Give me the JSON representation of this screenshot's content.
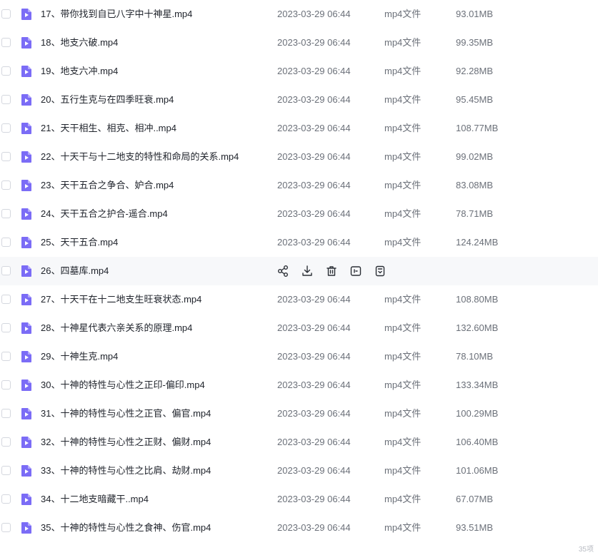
{
  "files": [
    {
      "name": "17、带你找到自已八字中十神星.mp4",
      "date": "2023-03-29 06:44",
      "type": "mp4文件",
      "size": "93.01MB"
    },
    {
      "name": "18、地支六破.mp4",
      "date": "2023-03-29 06:44",
      "type": "mp4文件",
      "size": "99.35MB"
    },
    {
      "name": "19、地支六冲.mp4",
      "date": "2023-03-29 06:44",
      "type": "mp4文件",
      "size": "92.28MB"
    },
    {
      "name": "20、五行生克与在四季旺衰.mp4",
      "date": "2023-03-29 06:44",
      "type": "mp4文件",
      "size": "95.45MB"
    },
    {
      "name": "21、天干相生、相克、相冲..mp4",
      "date": "2023-03-29 06:44",
      "type": "mp4文件",
      "size": "108.77MB"
    },
    {
      "name": "22、十天干与十二地支的特性和命局的关系.mp4",
      "date": "2023-03-29 06:44",
      "type": "mp4文件",
      "size": "99.02MB"
    },
    {
      "name": "23、天干五合之争合、妒合.mp4",
      "date": "2023-03-29 06:44",
      "type": "mp4文件",
      "size": "83.08MB"
    },
    {
      "name": "24、天干五合之护合-遥合.mp4",
      "date": "2023-03-29 06:44",
      "type": "mp4文件",
      "size": "78.71MB"
    },
    {
      "name": "25、天干五合.mp4",
      "date": "2023-03-29 06:44",
      "type": "mp4文件",
      "size": "124.24MB"
    },
    {
      "name": "26、四墓库.mp4",
      "date": "",
      "type": "",
      "size": "",
      "hover": true
    },
    {
      "name": "27、十天干在十二地支生旺衰状态.mp4",
      "date": "2023-03-29 06:44",
      "type": "mp4文件",
      "size": "108.80MB"
    },
    {
      "name": "28、十神星代表六亲关系的原理.mp4",
      "date": "2023-03-29 06:44",
      "type": "mp4文件",
      "size": "132.60MB"
    },
    {
      "name": "29、十神生克.mp4",
      "date": "2023-03-29 06:44",
      "type": "mp4文件",
      "size": "78.10MB"
    },
    {
      "name": "30、十神的特性与心性之正印-偏印.mp4",
      "date": "2023-03-29 06:44",
      "type": "mp4文件",
      "size": "133.34MB"
    },
    {
      "name": "31、十神的特性与心性之正官、偏官.mp4",
      "date": "2023-03-29 06:44",
      "type": "mp4文件",
      "size": "100.29MB"
    },
    {
      "name": "32、十神的特性与心性之正财、偏财.mp4",
      "date": "2023-03-29 06:44",
      "type": "mp4文件",
      "size": "106.40MB"
    },
    {
      "name": "33、十神的特性与心性之比肩、劫财.mp4",
      "date": "2023-03-29 06:44",
      "type": "mp4文件",
      "size": "101.06MB"
    },
    {
      "name": "34、十二地支暗藏干..mp4",
      "date": "2023-03-29 06:44",
      "type": "mp4文件",
      "size": "67.07MB"
    },
    {
      "name": "35、十神的特性与心性之食神、伤官.mp4",
      "date": "2023-03-29 06:44",
      "type": "mp4文件",
      "size": "93.51MB"
    }
  ],
  "hover_actions": [
    {
      "icon": "share-icon"
    },
    {
      "icon": "download-icon"
    },
    {
      "icon": "delete-icon"
    },
    {
      "icon": "preview-icon"
    },
    {
      "icon": "more-icon"
    }
  ],
  "watermark": "35项",
  "colors": {
    "file_icon": "#7b6cf6",
    "hover_row": "#f7f8fa",
    "text_primary": "#20242c",
    "text_secondary": "#6b7079"
  }
}
